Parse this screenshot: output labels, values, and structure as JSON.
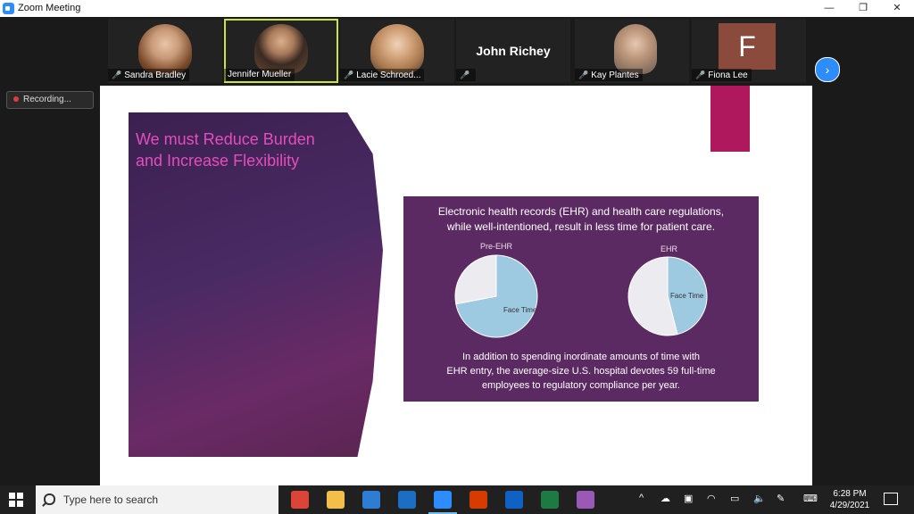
{
  "window": {
    "title": "Zoom Meeting",
    "controls": {
      "minimize": "—",
      "restore": "❐",
      "close": "✕"
    }
  },
  "participants": [
    {
      "name": "Sandra Bradley",
      "muted": true
    },
    {
      "name": "Jennifer Mueller",
      "muted": false,
      "active_speaker": true
    },
    {
      "name": "Lacie Schroed...",
      "muted": true
    },
    {
      "name": "John Richey",
      "muted": true,
      "video_off": true
    },
    {
      "name": "Kay Plantes",
      "muted": true
    },
    {
      "name": "Fiona Lee",
      "muted": true,
      "video_off": true,
      "initial": "F"
    }
  ],
  "gallery": {
    "next_icon": "chevron-right-icon",
    "next_glyph": "›"
  },
  "recording": {
    "label": "Recording..."
  },
  "slide": {
    "title_line1": "We must Reduce Burden",
    "title_line2": "and Increase Flexibility",
    "info_heading_line1": "Electronic health records (EHR) and health care regulations,",
    "info_heading_line2": "while well-intentioned, result in less time for patient care.",
    "info_footer_line1": "In addition to spending inordinate amounts of time with",
    "info_footer_line2": "EHR entry, the average-size U.S. hospital devotes 59 full-time",
    "info_footer_line3": "employees to regulatory compliance per year.",
    "colors": {
      "title": "#e44dbb",
      "box": "#5c2a62",
      "face_time": "#9ecae1",
      "other": "#ecebf0"
    }
  },
  "chart_data": [
    {
      "type": "pie",
      "title": "Pre-EHR",
      "slices": [
        {
          "label": "Face Time",
          "value": 72
        },
        {
          "label": "",
          "value": 28
        }
      ]
    },
    {
      "type": "pie",
      "title": "EHR",
      "slices": [
        {
          "label": "Face Time",
          "value": 46
        },
        {
          "label": "",
          "value": 54
        }
      ]
    }
  ],
  "taskbar": {
    "search_placeholder": "Type here to search",
    "apps": [
      {
        "name": "chrome",
        "color": "#db4437"
      },
      {
        "name": "file-explorer",
        "color": "#f2c04a"
      },
      {
        "name": "store",
        "color": "#2d7dd2"
      },
      {
        "name": "mail",
        "color": "#1b6ec2"
      },
      {
        "name": "zoom",
        "color": "#2d8cff",
        "running": true
      },
      {
        "name": "office",
        "color": "#d83b01"
      },
      {
        "name": "outlook",
        "color": "#0f62c4"
      },
      {
        "name": "excel",
        "color": "#1d7a43"
      },
      {
        "name": "other-app",
        "color": "#9b59b6"
      }
    ],
    "tray": {
      "caret": "^",
      "time": "6:28 PM",
      "date": "4/29/2021"
    }
  }
}
